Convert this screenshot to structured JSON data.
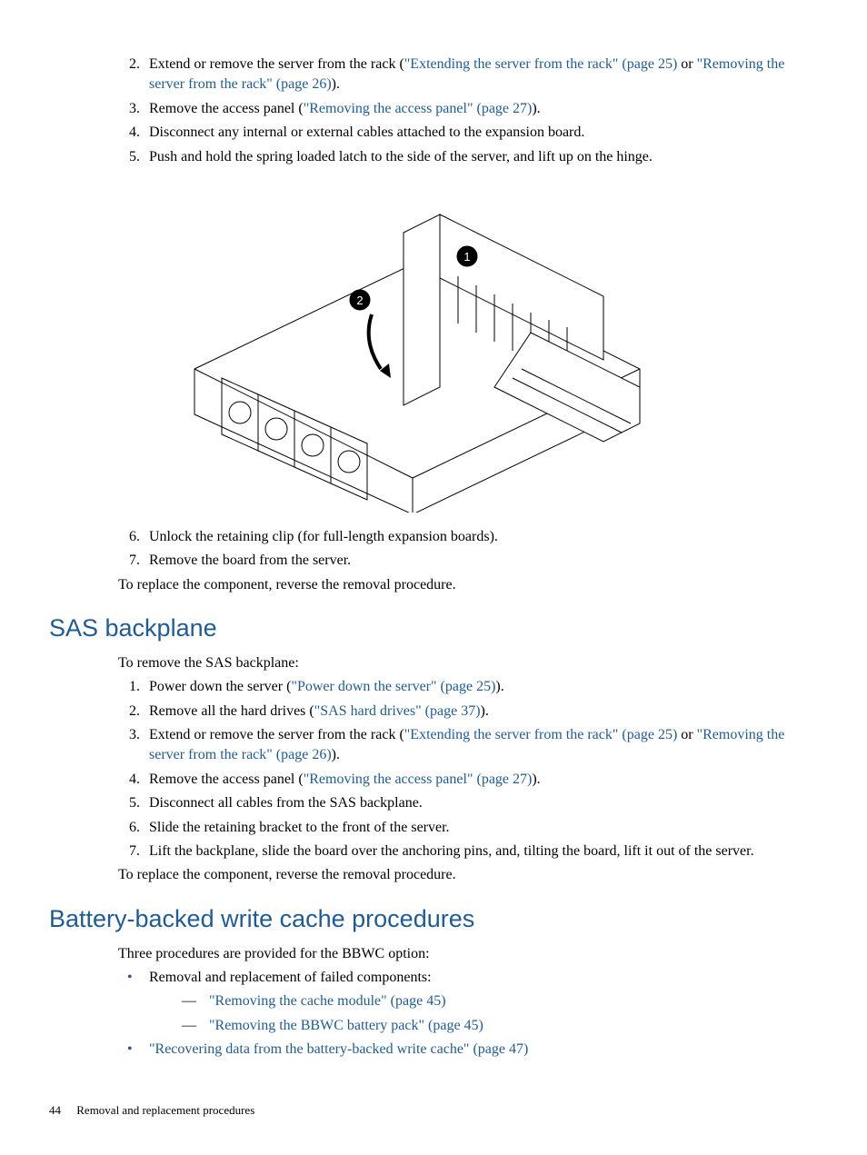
{
  "topSteps": [
    {
      "n": "2.",
      "pre": "Extend or remove the server from the rack (",
      "link1": "\"Extending the server from the rack\" (page 25)",
      "mid": " or ",
      "link2": "\"Removing the server from the rack\" (page 26)",
      "post": ")."
    },
    {
      "n": "3.",
      "pre": "Remove the access panel (",
      "link1": "\"Removing the access panel\" (page 27)",
      "mid": "",
      "link2": "",
      "post": ")."
    },
    {
      "n": "4.",
      "pre": "Disconnect any internal or external cables attached to the expansion board.",
      "link1": "",
      "mid": "",
      "link2": "",
      "post": ""
    },
    {
      "n": "5.",
      "pre": "Push and hold the spring loaded latch to the side of the server, and lift up on the hinge.",
      "link1": "",
      "mid": "",
      "link2": "",
      "post": ""
    }
  ],
  "figure": {
    "callout1": "1",
    "callout2": "2"
  },
  "afterFigSteps": [
    {
      "n": "6.",
      "pre": "Unlock the retaining clip (for full-length expansion boards).",
      "link1": "",
      "mid": "",
      "link2": "",
      "post": ""
    },
    {
      "n": "7.",
      "pre": "Remove the board from the server.",
      "link1": "",
      "mid": "",
      "link2": "",
      "post": ""
    }
  ],
  "replacePara": "To replace the component, reverse the removal procedure.",
  "sasHeading": "SAS backplane",
  "sasIntro": "To remove the SAS backplane:",
  "sasSteps": [
    {
      "n": "1.",
      "pre": "Power down the server (",
      "link1": "\"Power down the server\" (page 25)",
      "mid": "",
      "link2": "",
      "post": ")."
    },
    {
      "n": "2.",
      "pre": "Remove all the hard drives (",
      "link1": "\"SAS hard drives\" (page 37)",
      "mid": "",
      "link2": "",
      "post": ")."
    },
    {
      "n": "3.",
      "pre": "Extend or remove the server from the rack (",
      "link1": "\"Extending the server from the rack\" (page 25)",
      "mid": " or ",
      "link2": "\"Removing the server from the rack\" (page 26)",
      "post": ")."
    },
    {
      "n": "4.",
      "pre": "Remove the access panel (",
      "link1": "\"Removing the access panel\" (page 27)",
      "mid": "",
      "link2": "",
      "post": ")."
    },
    {
      "n": "5.",
      "pre": "Disconnect all cables from the SAS backplane.",
      "link1": "",
      "mid": "",
      "link2": "",
      "post": ""
    },
    {
      "n": "6.",
      "pre": "Slide the retaining bracket to the front of the server.",
      "link1": "",
      "mid": "",
      "link2": "",
      "post": ""
    },
    {
      "n": "7.",
      "pre": "Lift the backplane, slide the board over the anchoring pins, and, tilting the board, lift it out of the server.",
      "link1": "",
      "mid": "",
      "link2": "",
      "post": ""
    }
  ],
  "bbwcHeading": "Battery-backed write cache procedures",
  "bbwcIntro": "Three procedures are provided for the BBWC option:",
  "bbwcBullets": {
    "b1text": "Removal and replacement of failed components:",
    "b1sub1": "\"Removing the cache module\" (page 45)",
    "b1sub2": "\"Removing the BBWC battery pack\" (page 45)",
    "b2link": "\"Recovering data from the battery-backed write cache\" (page 47)"
  },
  "footer": {
    "page": "44",
    "chapter": "Removal and replacement procedures"
  }
}
